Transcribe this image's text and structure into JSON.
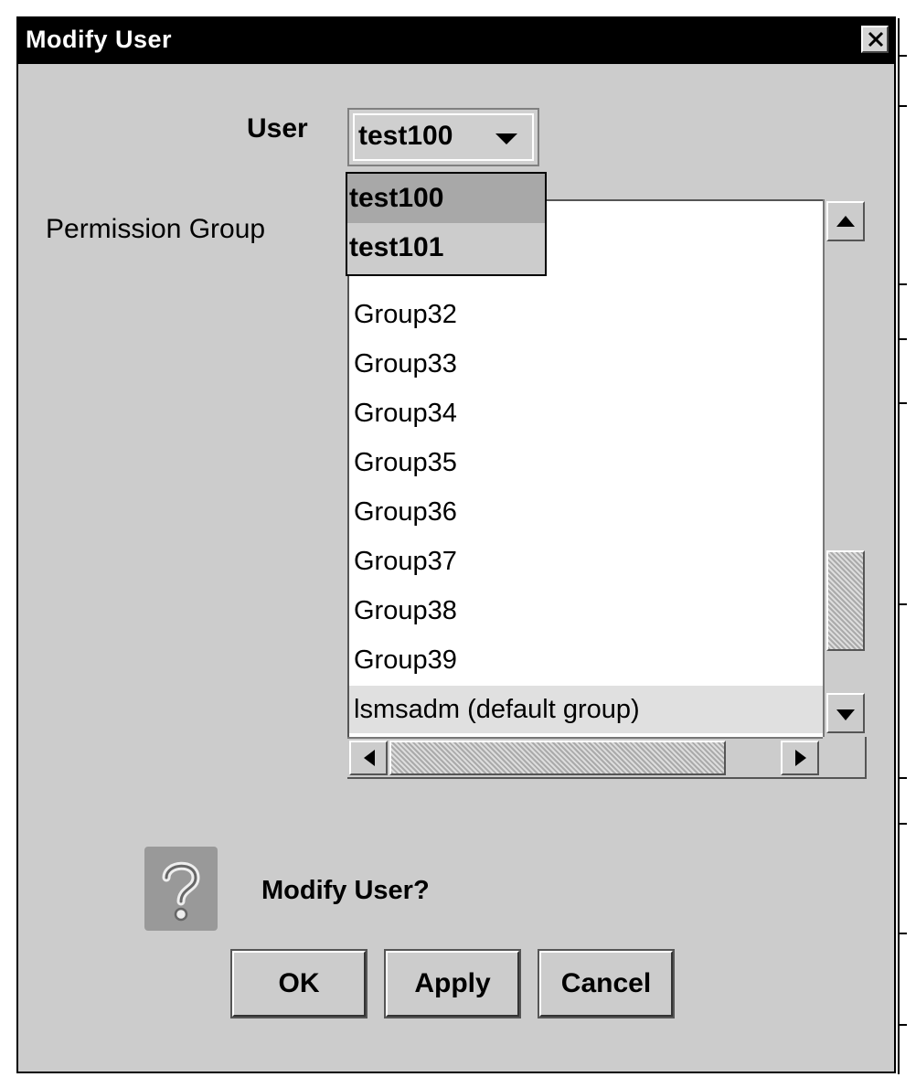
{
  "window": {
    "title": "Modify User"
  },
  "user": {
    "label": "User",
    "selected": "test100",
    "options": [
      "test100",
      "test101"
    ]
  },
  "permission_group": {
    "label": "Permission Group",
    "items": [
      "Group32",
      "Group33",
      "Group34",
      "Group35",
      "Group36",
      "Group37",
      "Group38",
      "Group39",
      "lsmsadm (default group)"
    ],
    "selected": "lsmsadm (default group)"
  },
  "prompt": {
    "text": "Modify User?"
  },
  "buttons": {
    "ok": "OK",
    "apply": "Apply",
    "cancel": "Cancel"
  },
  "icons": {
    "close": "close-icon",
    "question": "question-icon"
  }
}
